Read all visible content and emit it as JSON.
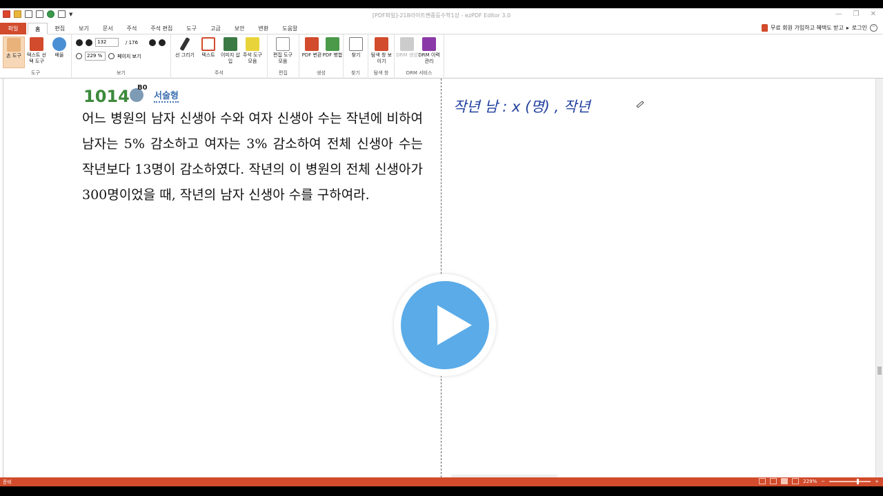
{
  "window": {
    "title": "[PDF파일]-218라이트쎈중등수학1상 - ezPDF Editor 3.0",
    "controls": [
      "—",
      "❐",
      "✕"
    ]
  },
  "menu": {
    "file": "파일",
    "tabs": [
      "홈",
      "편집",
      "보기",
      "문서",
      "주석",
      "주석 편집",
      "도구",
      "고급",
      "보안",
      "변환",
      "도움말"
    ],
    "promo": "무료 회원 가입하고 혜택도 받고",
    "login": "로그인"
  },
  "ribbon": {
    "tools": {
      "label": "도구",
      "hand": "손 도구",
      "text_select": "텍스트 선택 도구",
      "zoom": "배율"
    },
    "view": {
      "label": "보기",
      "page": "132",
      "total": "/ 176",
      "zoom": "229 %",
      "page_view": "페이지 보기"
    },
    "annot": {
      "label": "주석",
      "line": "선 그리기",
      "text": "텍스트",
      "image": "이미지 삽입",
      "toolset": "주석 도구 모음"
    },
    "edit": {
      "label": "편집",
      "edit_tools": "편집 도구 모음"
    },
    "create": {
      "label": "생성",
      "pdf_convert": "PDF 변환",
      "pdf_merge": "PDF 병합"
    },
    "find": {
      "label": "찾기",
      "find": "찾기"
    },
    "navpane": {
      "label": "탐색 창",
      "show": "탐색 창 보이기"
    },
    "drm": {
      "label": "DRM 서비스",
      "create": "DRM 생성",
      "history": "DRM 이력 관리"
    }
  },
  "document": {
    "question_number": "1014",
    "badge": "B0",
    "question_type": "서술형",
    "question_text": "어느 병원의 남자 신생아 수와 여자 신생아 수는 작년에 비하여 남자는 5% 감소하고 여자는 3% 감소하여 전체 신생아 수는 작년보다 13명이 감소하였다. 작년의 이 병원의 전체 신생아가 300명이었을 때, 작년의 남자 신생아 수를 구하여라.",
    "handwritten_note": "작년 남 : x (명) , 작년"
  },
  "status": {
    "left": "준비",
    "zoom": "229%"
  },
  "colors": {
    "accent": "#d14b2c",
    "question_green": "#3d8a3c",
    "play_blue": "#5aabe8",
    "ink_blue": "#1f3f9e"
  }
}
